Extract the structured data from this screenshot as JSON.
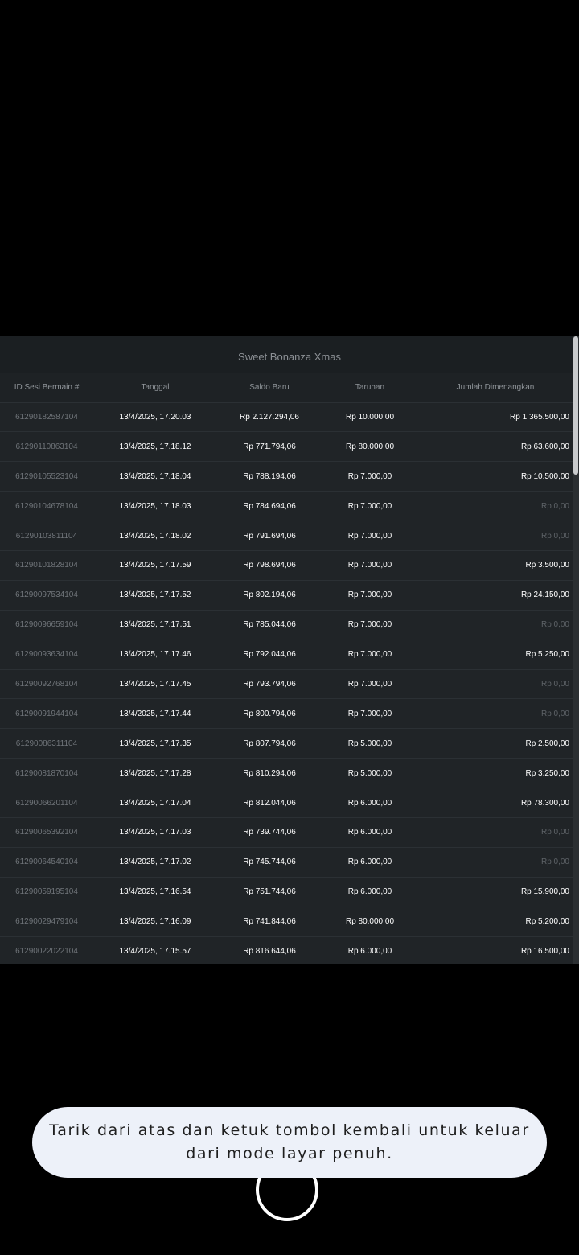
{
  "title": "Sweet Bonanza Xmas",
  "columns": [
    "ID Sesi Bermain #",
    "Tanggal",
    "Saldo Baru",
    "Taruhan",
    "Jumlah Dimenangkan"
  ],
  "rows": [
    {
      "id": "61290182587104",
      "date": "13/4/2025, 17.20.03",
      "saldo": "Rp 2.127.294,06",
      "bet": "Rp 10.000,00",
      "win": "Rp 1.365.500,00",
      "zero": false
    },
    {
      "id": "61290110863104",
      "date": "13/4/2025, 17.18.12",
      "saldo": "Rp 771.794,06",
      "bet": "Rp 80.000,00",
      "win": "Rp 63.600,00",
      "zero": false
    },
    {
      "id": "61290105523104",
      "date": "13/4/2025, 17.18.04",
      "saldo": "Rp 788.194,06",
      "bet": "Rp 7.000,00",
      "win": "Rp 10.500,00",
      "zero": false
    },
    {
      "id": "61290104678104",
      "date": "13/4/2025, 17.18.03",
      "saldo": "Rp 784.694,06",
      "bet": "Rp 7.000,00",
      "win": "Rp 0,00",
      "zero": true
    },
    {
      "id": "61290103811104",
      "date": "13/4/2025, 17.18.02",
      "saldo": "Rp 791.694,06",
      "bet": "Rp 7.000,00",
      "win": "Rp 0,00",
      "zero": true
    },
    {
      "id": "61290101828104",
      "date": "13/4/2025, 17.17.59",
      "saldo": "Rp 798.694,06",
      "bet": "Rp 7.000,00",
      "win": "Rp 3.500,00",
      "zero": false
    },
    {
      "id": "61290097534104",
      "date": "13/4/2025, 17.17.52",
      "saldo": "Rp 802.194,06",
      "bet": "Rp 7.000,00",
      "win": "Rp 24.150,00",
      "zero": false
    },
    {
      "id": "61290096659104",
      "date": "13/4/2025, 17.17.51",
      "saldo": "Rp 785.044,06",
      "bet": "Rp 7.000,00",
      "win": "Rp 0,00",
      "zero": true
    },
    {
      "id": "61290093634104",
      "date": "13/4/2025, 17.17.46",
      "saldo": "Rp 792.044,06",
      "bet": "Rp 7.000,00",
      "win": "Rp 5.250,00",
      "zero": false
    },
    {
      "id": "61290092768104",
      "date": "13/4/2025, 17.17.45",
      "saldo": "Rp 793.794,06",
      "bet": "Rp 7.000,00",
      "win": "Rp 0,00",
      "zero": true
    },
    {
      "id": "61290091944104",
      "date": "13/4/2025, 17.17.44",
      "saldo": "Rp 800.794,06",
      "bet": "Rp 7.000,00",
      "win": "Rp 0,00",
      "zero": true
    },
    {
      "id": "61290086311104",
      "date": "13/4/2025, 17.17.35",
      "saldo": "Rp 807.794,06",
      "bet": "Rp 5.000,00",
      "win": "Rp 2.500,00",
      "zero": false
    },
    {
      "id": "61290081870104",
      "date": "13/4/2025, 17.17.28",
      "saldo": "Rp 810.294,06",
      "bet": "Rp 5.000,00",
      "win": "Rp 3.250,00",
      "zero": false
    },
    {
      "id": "61290066201104",
      "date": "13/4/2025, 17.17.04",
      "saldo": "Rp 812.044,06",
      "bet": "Rp 6.000,00",
      "win": "Rp 78.300,00",
      "zero": false
    },
    {
      "id": "61290065392104",
      "date": "13/4/2025, 17.17.03",
      "saldo": "Rp 739.744,06",
      "bet": "Rp 6.000,00",
      "win": "Rp 0,00",
      "zero": true
    },
    {
      "id": "61290064540104",
      "date": "13/4/2025, 17.17.02",
      "saldo": "Rp 745.744,06",
      "bet": "Rp 6.000,00",
      "win": "Rp 0,00",
      "zero": true
    },
    {
      "id": "61290059195104",
      "date": "13/4/2025, 17.16.54",
      "saldo": "Rp 751.744,06",
      "bet": "Rp 6.000,00",
      "win": "Rp 15.900,00",
      "zero": false
    },
    {
      "id": "61290029479104",
      "date": "13/4/2025, 17.16.09",
      "saldo": "Rp 741.844,06",
      "bet": "Rp 80.000,00",
      "win": "Rp 5.200,00",
      "zero": false
    },
    {
      "id": "61290022022104",
      "date": "13/4/2025, 17.15.57",
      "saldo": "Rp 816.644,06",
      "bet": "Rp 6.000,00",
      "win": "Rp 16.500,00",
      "zero": false
    }
  ],
  "toast": {
    "line1": "Tarik dari atas dan ketuk tombol kembali untuk keluar",
    "line2": "dari mode layar penuh."
  },
  "colors": {
    "background": "#000000",
    "panel": "#202427",
    "toast_bg": "#edf1f9",
    "zero_text": "#5d6267",
    "id_text": "#6f7479"
  }
}
